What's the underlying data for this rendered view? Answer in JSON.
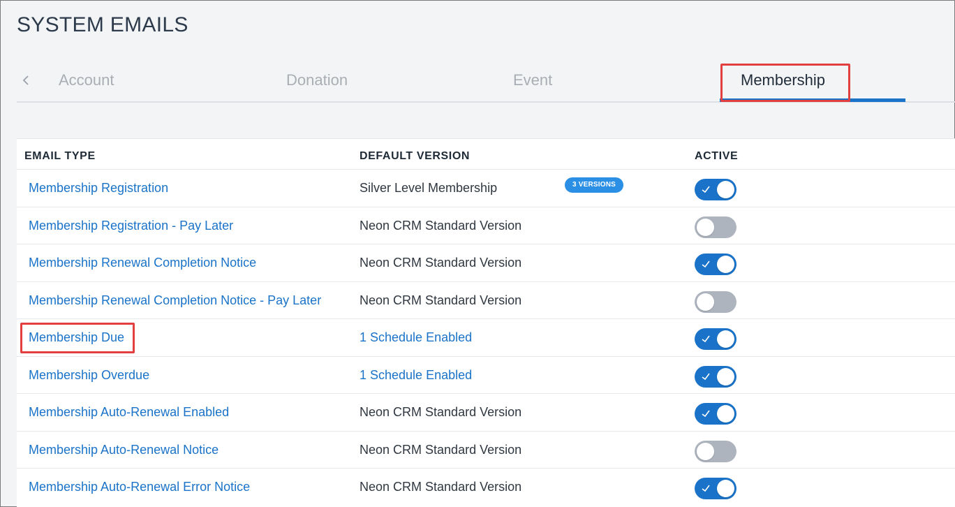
{
  "page": {
    "title": "SYSTEM EMAILS"
  },
  "tabs": {
    "back_icon": "chevron-left-icon",
    "items": [
      {
        "label": "Account",
        "active": false
      },
      {
        "label": "Donation",
        "active": false
      },
      {
        "label": "Event",
        "active": false
      },
      {
        "label": "Membership",
        "active": true
      }
    ]
  },
  "table": {
    "headers": {
      "email_type": "EMAIL TYPE",
      "default_version": "DEFAULT VERSION",
      "active": "ACTIVE"
    },
    "rows": [
      {
        "email_type": "Membership Registration",
        "default_version": "Silver Level Membership",
        "version_link": false,
        "badge": "3 VERSIONS",
        "active": true
      },
      {
        "email_type": "Membership Registration - Pay Later",
        "default_version": "Neon CRM Standard Version",
        "version_link": false,
        "badge": "",
        "active": false
      },
      {
        "email_type": "Membership Renewal Completion Notice",
        "default_version": "Neon CRM Standard Version",
        "version_link": false,
        "badge": "",
        "active": true
      },
      {
        "email_type": "Membership Renewal Completion Notice - Pay Later",
        "default_version": "Neon CRM Standard Version",
        "version_link": false,
        "badge": "",
        "active": false
      },
      {
        "email_type": "Membership Due",
        "default_version": "1 Schedule Enabled",
        "version_link": true,
        "badge": "",
        "active": true
      },
      {
        "email_type": "Membership Overdue",
        "default_version": "1 Schedule Enabled",
        "version_link": true,
        "badge": "",
        "active": true
      },
      {
        "email_type": "Membership Auto-Renewal Enabled",
        "default_version": "Neon CRM Standard Version",
        "version_link": false,
        "badge": "",
        "active": true
      },
      {
        "email_type": "Membership Auto-Renewal Notice",
        "default_version": "Neon CRM Standard Version",
        "version_link": false,
        "badge": "",
        "active": false
      },
      {
        "email_type": "Membership Auto-Renewal Error Notice",
        "default_version": "Neon CRM Standard Version",
        "version_link": false,
        "badge": "",
        "active": true
      }
    ]
  },
  "colors": {
    "accent": "#1a73c8",
    "highlight": "#e24040",
    "toggle_off": "#aeb4be"
  }
}
